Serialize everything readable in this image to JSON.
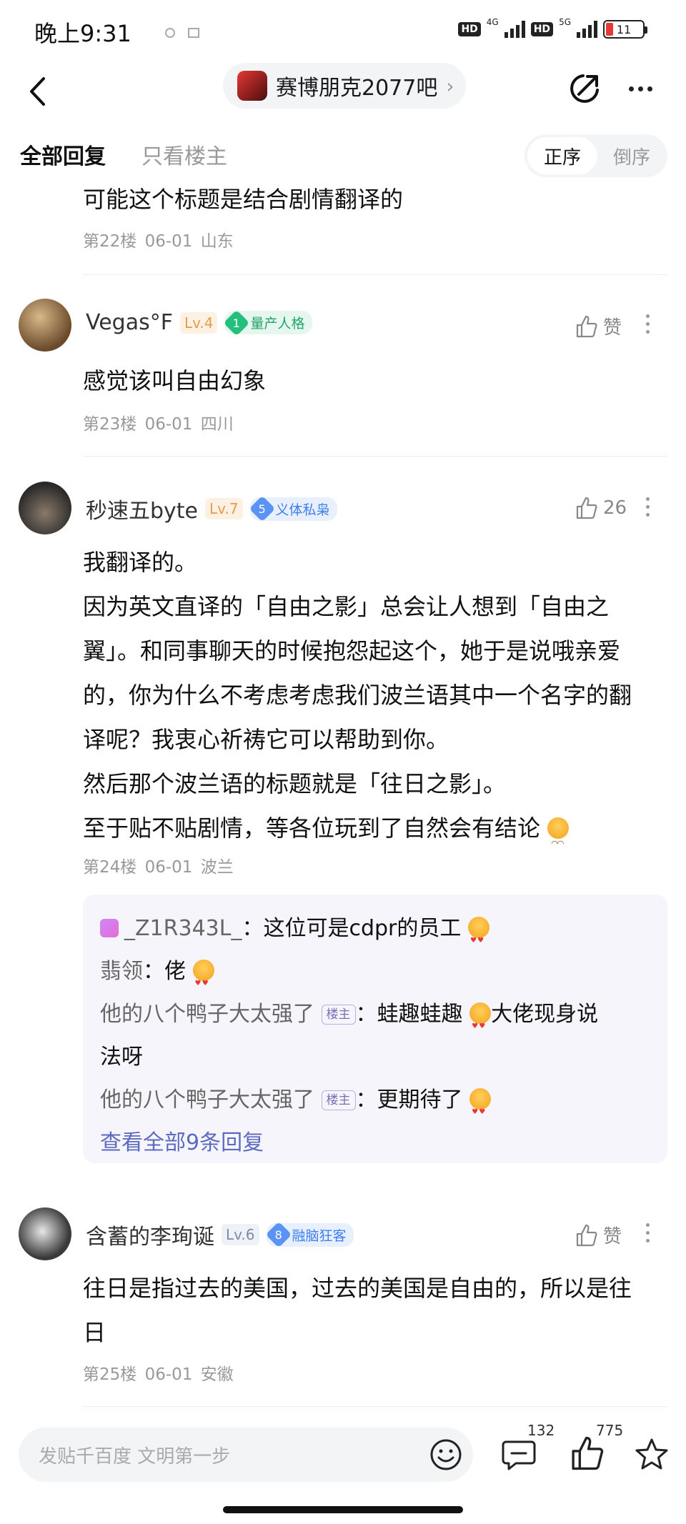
{
  "status_bar": {
    "time": "晚上9:31",
    "net1": "4G",
    "net2": "5G",
    "battery": "11",
    "hd": "HD"
  },
  "header": {
    "forum_name": "赛博朋克2077吧"
  },
  "filters": {
    "all_replies": "全部回复",
    "only_op": "只看楼主",
    "asc": "正序",
    "desc": "倒序"
  },
  "posts": [
    {
      "text": "可能这个标题是结合剧情翻译的",
      "floor": "第22楼",
      "date": "06-01",
      "region": "山东"
    },
    {
      "username": "Vegas°F",
      "level": "Lv.4",
      "honor_num": "1",
      "honor": "量产人格",
      "likes": "赞",
      "text": "感觉该叫自由幻象",
      "floor": "第23楼",
      "date": "06-01",
      "region": "四川"
    },
    {
      "username": "秒速五byte",
      "level": "Lv.7",
      "honor_num": "5",
      "honor": "义体私枭",
      "likes": "26",
      "lines": [
        "我翻译的。",
        "因为英文直译的「自由之影」总会让人想到「自由之",
        "翼」。和同事聊天的时候抱怨起这个，她于是说哦亲爱",
        "的，你为什么不考虑考虑我们波兰语其中一个名字的翻",
        "译呢？我衷心祈祷它可以帮助到你。",
        "然后那个波兰语的标题就是「往日之影」。",
        "至于贴不贴剧情，等各位玩到了自然会有结论"
      ],
      "floor": "第24楼",
      "date": "06-01",
      "region": "波兰",
      "replies": [
        {
          "author": "_Z1R343L_",
          "text": "这位可是cdpr的员工"
        },
        {
          "author": "翡领",
          "text": "佬"
        },
        {
          "author": "他的八个鸭子大太强了",
          "tag": "楼主",
          "text": "蛙趣蛙趣",
          "text2": "大佬现身说",
          "text3": "法呀"
        },
        {
          "author": "他的八个鸭子大太强了",
          "tag": "楼主",
          "text": "更期待了"
        }
      ],
      "view_all": "查看全部9条回复"
    },
    {
      "username": "含蓄的李珣诞",
      "level": "Lv.6",
      "honor_num": "8",
      "honor": "融脑狂客",
      "likes": "赞",
      "line1": "往日是指过去的美国，过去的美国是自由的，所以是往",
      "line2": "日",
      "floor": "第25楼",
      "date": "06-01",
      "region": "安徽"
    }
  ],
  "bottom_bar": {
    "placeholder": "发贴千百度 文明第一步",
    "comments": "132",
    "likes": "775"
  },
  "colors": {
    "accent": "#5c6bc0",
    "level": "#e89b4a",
    "green_honor": "#22a56b",
    "blue_honor": "#3d7ef0"
  }
}
